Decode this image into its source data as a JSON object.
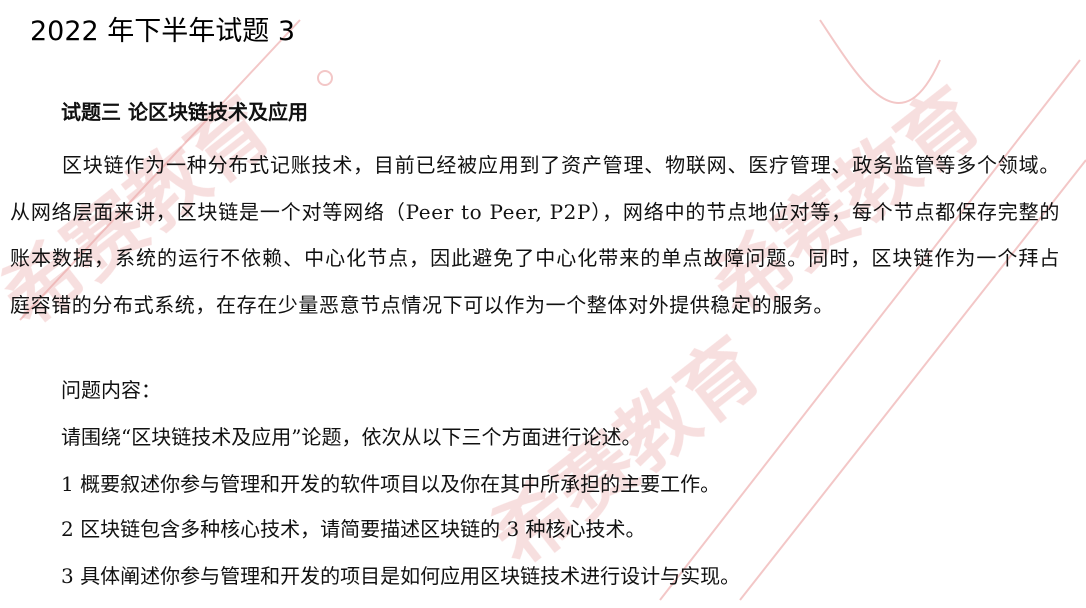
{
  "page_title": "2022 年下半年试题 3",
  "question_title": "试题三 论区块链技术及应用",
  "body_paragraph": "区块链作为一种分布式记账技术，目前已经被应用到了资产管理、物联网、医疗管理、政务监管等多个领域。从网络层面来讲，区块链是一个对等网络（Peer to Peer, P2P），网络中的节点地位对等，每个节点都保存完整的账本数据，系统的运行不依赖、中心化节点，因此避免了中心化带来的单点故障问题。同时，区块链作为一个拜占庭容错的分布式系统，在存在少量恶意节点情况下可以作为一个整体对外提供稳定的服务。",
  "question_label": "问题内容：",
  "instruction": "请围绕“区块链技术及应用”论题，依次从以下三个方面进行论述。",
  "items": [
    "1 概要叙述你参与管理和开发的软件项目以及你在其中所承担的主要工作。",
    "2 区块链包含多种核心技术，请简要描述区块链的 3 种核心技术。",
    "3 具体阐述你参与管理和开发的项目是如何应用区块链技术进行设计与实现。"
  ],
  "watermark": "希赛教育",
  "colors": {
    "text": "#111111",
    "watermark": "#e8a6a6"
  }
}
